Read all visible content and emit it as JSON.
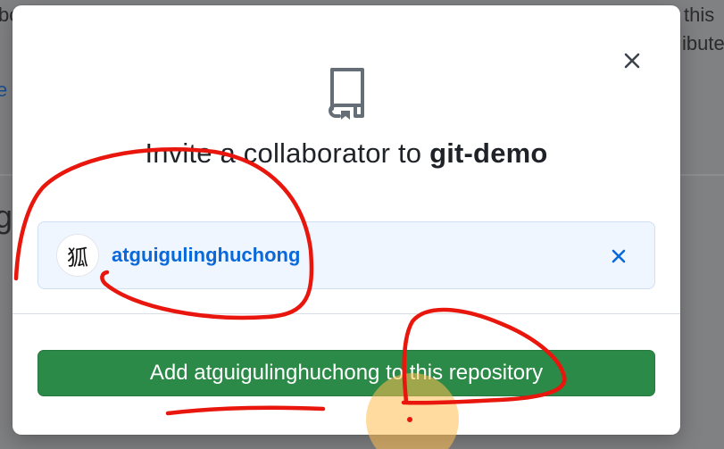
{
  "background": {
    "fragments": [
      "bo",
      "this",
      "ibute",
      "e",
      "g"
    ]
  },
  "modal": {
    "title_prefix": "Invite a collaborator to ",
    "repo_name": "git-demo",
    "close_icon": "close-icon",
    "repo_icon": "repo-book-icon"
  },
  "selected_user": {
    "avatar_char": "狐",
    "username": "atguigulinghuchong",
    "remove_icon": "close-icon"
  },
  "action": {
    "add_label": "Add atguigulinghuchong to this repository"
  },
  "colors": {
    "primary_button": "#2b8a48",
    "link": "#0a69da",
    "annotation": "#e8160c"
  }
}
